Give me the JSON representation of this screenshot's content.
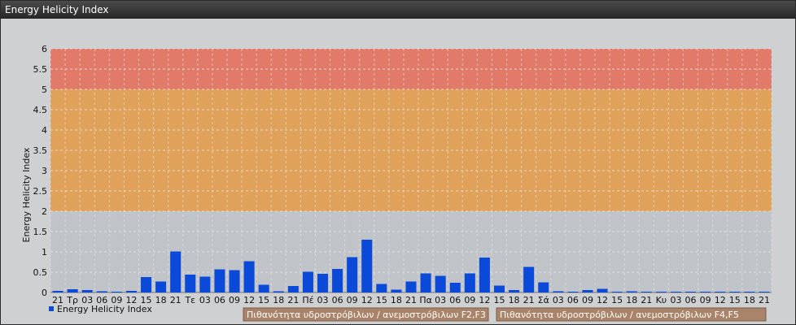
{
  "window": {
    "title": "Energy Helicity Index"
  },
  "colors": {
    "bar": "#0b49d8",
    "band_low": "#e0a25a",
    "band_high": "#e27a6a",
    "plot_bg": "#c0c4c8",
    "grid": "#e6e6e6"
  },
  "chart_data": {
    "type": "bar",
    "title": "",
    "xlabel": "",
    "ylabel": "Energy Helicity Index",
    "ylim": [
      0,
      6
    ],
    "yticks": [
      "0",
      "0.5",
      "1",
      "1.5",
      "2",
      "2.5",
      "3",
      "3.5",
      "4",
      "4.5",
      "5",
      "5.5",
      "6"
    ],
    "grid": true,
    "legend_position": "bottom-left",
    "categories": [
      "21",
      "Τρ",
      "03",
      "06",
      "09",
      "12",
      "15",
      "18",
      "21",
      "Τε",
      "03",
      "06",
      "09",
      "12",
      "15",
      "18",
      "21",
      "Πέ",
      "03",
      "06",
      "09",
      "12",
      "15",
      "18",
      "21",
      "Πα",
      "03",
      "06",
      "09",
      "12",
      "15",
      "18",
      "21",
      "Σά",
      "03",
      "06",
      "09",
      "12",
      "15",
      "18",
      "21",
      "Κυ",
      "03",
      "06",
      "09",
      "12",
      "15",
      "18",
      "21"
    ],
    "series": [
      {
        "name": "Energy Helicity Index",
        "values": [
          0.04,
          0.08,
          0.06,
          0.03,
          0.02,
          0.04,
          0.38,
          0.27,
          1.01,
          0.44,
          0.39,
          0.57,
          0.55,
          0.77,
          0.19,
          0.03,
          0.16,
          0.51,
          0.46,
          0.58,
          0.87,
          1.3,
          0.21,
          0.07,
          0.27,
          0.47,
          0.41,
          0.24,
          0.47,
          0.86,
          0.17,
          0.06,
          0.63,
          0.25,
          0.03,
          0.02,
          0.06,
          0.09,
          0.02,
          0.03,
          0.02,
          0.02,
          0.02,
          0.02,
          0.02,
          0.02,
          0.02,
          0.02,
          0.02
        ]
      }
    ],
    "bands": [
      {
        "from": 2,
        "to": 5,
        "label": "Πιθανότητα υδροστρόβιλων / ανεμοστρόβιλων F2,F3"
      },
      {
        "from": 5,
        "to": 6,
        "label": "Πιθανότητα υδροστρόβιλων / ανεμοστρόβιλων F4,F5"
      }
    ]
  }
}
